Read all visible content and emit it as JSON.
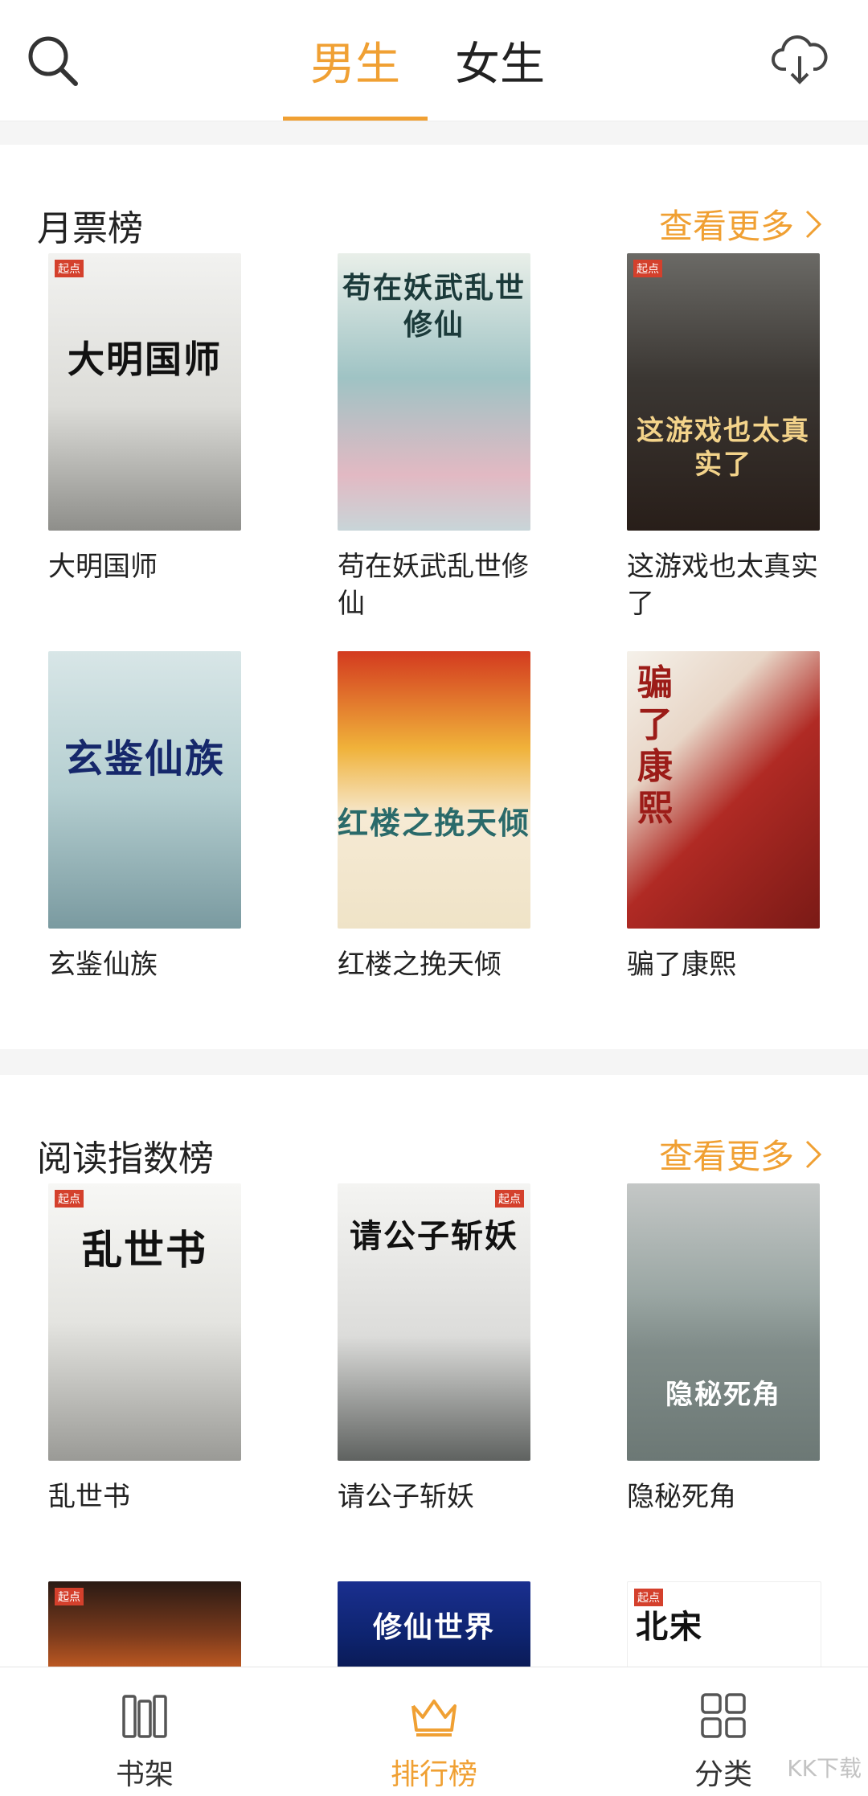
{
  "header": {
    "tabs": [
      {
        "label": "男生",
        "active": true
      },
      {
        "label": "女生",
        "active": false
      }
    ]
  },
  "sections": [
    {
      "title": "月票榜",
      "more": "查看更多",
      "books": [
        {
          "name": "大明国师",
          "cover_title": "大明国师"
        },
        {
          "name": "苟在妖武乱世修仙",
          "cover_title": "苟在妖武乱世修仙"
        },
        {
          "name": "这游戏也太真实了",
          "cover_title": "这游戏也太真实了"
        },
        {
          "name": "玄鉴仙族",
          "cover_title": "玄鉴仙族"
        },
        {
          "name": "红楼之挽天倾",
          "cover_title": "红楼之挽天倾"
        },
        {
          "name": "骗了康熙",
          "cover_title": "骗了康熙"
        }
      ]
    },
    {
      "title": "阅读指数榜",
      "more": "查看更多",
      "books": [
        {
          "name": "乱世书",
          "cover_title": "乱世书"
        },
        {
          "name": "请公子斩妖",
          "cover_title": "请公子斩妖"
        },
        {
          "name": "隐秘死角",
          "cover_title": "隐秘死角"
        },
        {
          "name": "",
          "cover_title": ""
        },
        {
          "name": "",
          "cover_title": "修仙世界"
        },
        {
          "name": "",
          "cover_title": "北宋"
        }
      ]
    }
  ],
  "bottom_nav": [
    {
      "label": "书架",
      "icon": "bookshelf-icon",
      "active": false
    },
    {
      "label": "排行榜",
      "icon": "crown-icon",
      "active": true
    },
    {
      "label": "分类",
      "icon": "grid-icon",
      "active": false
    }
  ],
  "colors": {
    "accent": "#f0a033"
  },
  "watermark": "KK下载"
}
